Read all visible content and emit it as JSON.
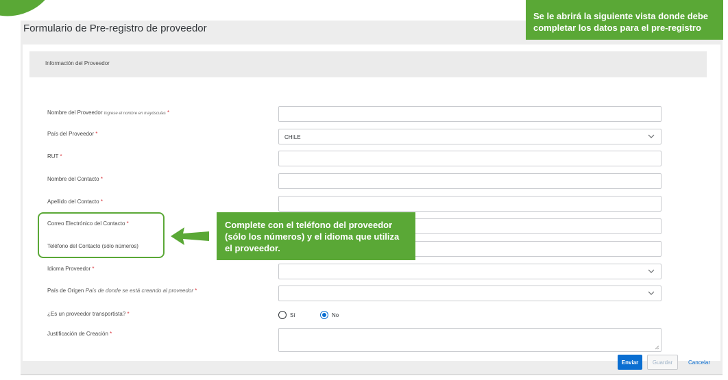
{
  "page": {
    "title": "Formulario de Pre-registro de proveedor"
  },
  "section": {
    "title": "Información del Proveedor"
  },
  "fields": {
    "supplier_name": {
      "label": "Nombre del Proveedor",
      "hint": "Ingrese el nombre en mayúsculas",
      "required": "*",
      "value": ""
    },
    "supplier_country": {
      "label": "País del Proveedor",
      "required": "*",
      "value": "CHILE"
    },
    "rut": {
      "label": "RUT",
      "required": "*",
      "value": ""
    },
    "contact_first_name": {
      "label": "Nombre del Contacto",
      "required": "*",
      "value": ""
    },
    "contact_last_name": {
      "label": "Apellido del Contacto",
      "required": "*",
      "value": ""
    },
    "contact_email": {
      "label": "Correo Electrónico del Contacto",
      "required": "*",
      "value": ""
    },
    "contact_phone": {
      "label": "Teléfono del Contacto (sólo números)",
      "value": ""
    },
    "supplier_language": {
      "label": "Idioma Proveedor",
      "required": "*",
      "value": ""
    },
    "origin_country": {
      "label": "País de Origen",
      "hint": "País de donde se está creando al proveedor",
      "required": "*",
      "value": ""
    },
    "is_carrier": {
      "label": "¿Es un proveedor transportista?",
      "required": "*",
      "options": [
        "Sí",
        "No"
      ],
      "selected": "No"
    },
    "justification": {
      "label": "Justificación de Creación",
      "required": "*",
      "value": ""
    }
  },
  "footer": {
    "send_label": "Enviar",
    "save_label": "Guardar",
    "cancel_label": "Cancelar"
  },
  "callouts": {
    "top": {
      "line1": "Se le abrirá la siguiente vista donde debe",
      "line2": "completar los datos para el pre-registro"
    },
    "middle": {
      "line1": "Complete con el teléfono del proveedor",
      "line2": "(sólo los números) y el idioma que utiliza",
      "line3": "el proveedor."
    }
  },
  "icons": {
    "dropdown": "chevron-down-icon",
    "arrow": "left-arrow-icon",
    "resize": "resize-grip-icon"
  },
  "colors": {
    "accent_green": "#5aa836",
    "primary_blue": "#0a6ed1",
    "required_red": "#d9363e",
    "frame_gray": "#ededed"
  }
}
